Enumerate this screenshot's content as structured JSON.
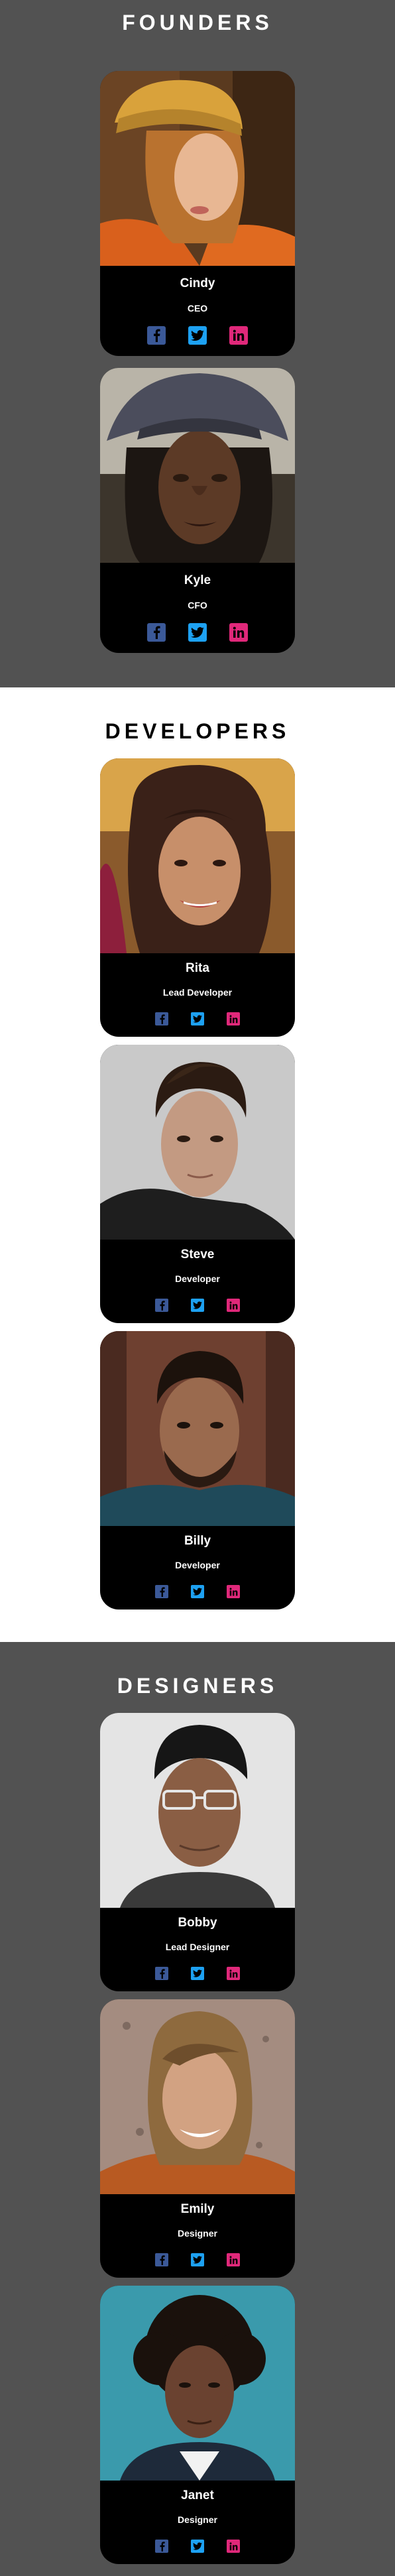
{
  "sections": [
    {
      "title": "FOUNDERS",
      "members": [
        {
          "name": "Cindy",
          "role": "CEO"
        },
        {
          "name": "Kyle",
          "role": "CFO"
        }
      ]
    },
    {
      "title": "DEVELOPERS",
      "members": [
        {
          "name": "Rita",
          "role": "Lead Developer"
        },
        {
          "name": "Steve",
          "role": "Developer"
        },
        {
          "name": "Billy",
          "role": "Developer"
        }
      ]
    },
    {
      "title": "DESIGNERS",
      "members": [
        {
          "name": "Bobby",
          "role": "Lead Designer"
        },
        {
          "name": "Emily",
          "role": "Designer"
        },
        {
          "name": "Janet",
          "role": "Designer"
        }
      ]
    }
  ],
  "social_icons": [
    "facebook-icon",
    "twitter-icon",
    "linkedin-icon"
  ],
  "colors": {
    "dark_section_bg": "#525252",
    "light_section_bg": "#ffffff",
    "card_bg": "#000000",
    "facebook": "#3b5998",
    "twitter": "#1da1f2",
    "linkedin": "#e0287a"
  }
}
